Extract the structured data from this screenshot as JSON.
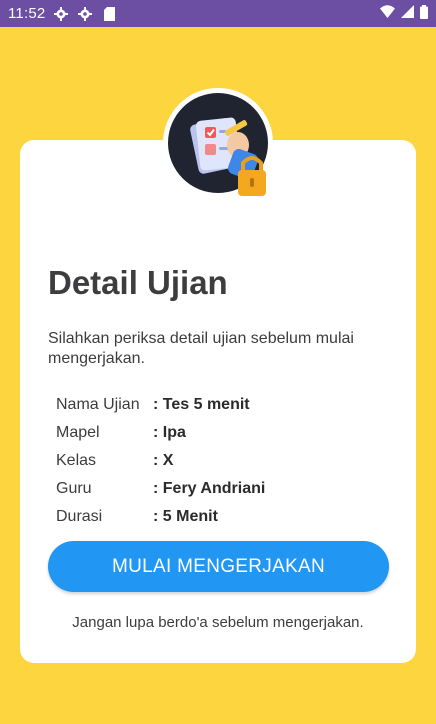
{
  "status_bar": {
    "time": "11:52",
    "left_icons": [
      "gear-icon",
      "gear-icon",
      "sd-card-icon"
    ],
    "right_icons": [
      "wifi-icon",
      "signal-icon",
      "battery-icon"
    ]
  },
  "colors": {
    "background": "#fdd63f",
    "status_bar": "#6c4fa3",
    "card": "#ffffff",
    "button": "#2196f3",
    "text": "#3d3d3f"
  },
  "header_icon": "exam-lock-icon",
  "page": {
    "title": "Detail Ujian",
    "description": "Silahkan periksa detail ujian sebelum mulai mengerjakan."
  },
  "details": [
    {
      "label": "Nama Ujian",
      "value": ": Tes 5 menit"
    },
    {
      "label": "Mapel",
      "value": ": Ipa"
    },
    {
      "label": "Kelas",
      "value": ": X"
    },
    {
      "label": "Guru",
      "value": ": Fery Andriani"
    },
    {
      "label": "Durasi",
      "value": ": 5 Menit"
    }
  ],
  "start_button": {
    "label": "MULAI MENGERJAKAN"
  },
  "footer_note": "Jangan lupa berdo'a sebelum mengerjakan."
}
